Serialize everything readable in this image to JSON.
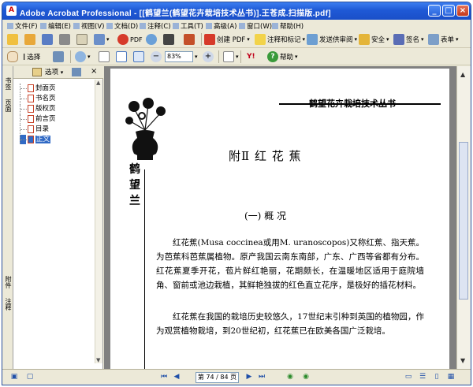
{
  "window": {
    "title": "Adobe Acrobat Professional - [[鹤望兰(鹤望花卉栽培技术丛书)].王苍成.扫描版.pdf]",
    "minimize": "_",
    "maximize": "□",
    "close": "×"
  },
  "menubar": {
    "items": [
      "文件(F)",
      "编辑(E)",
      "视图(V)",
      "文档(D)",
      "注释(C)",
      "工具(T)",
      "高级(A)",
      "窗口(W)",
      "帮助(H)"
    ]
  },
  "toolbar1": {
    "create_pdf_icon": "PDF",
    "create_pdf": "创建 PDF",
    "comment_markup": "注释和标记",
    "send_review": "发送供审阅",
    "security": "安全",
    "sign": "签名",
    "forms": "表单"
  },
  "toolbar2": {
    "select": "选择",
    "zoom": "83%",
    "help": "帮助"
  },
  "nav": {
    "tabs": [
      "书签",
      "页面",
      "附件",
      "注释"
    ],
    "options": "选项",
    "bookmarks": [
      "封面页",
      "书名页",
      "版权页",
      "前言页",
      "目录",
      "正文"
    ],
    "selected_index": 5
  },
  "document": {
    "header": "鹤望花卉栽培技术丛书",
    "side_title": "鹤望兰",
    "chapter": "附Ⅱ 红 花 蕉",
    "section": "(一) 概    况",
    "para1": "红花蕉(Musa coccinea或用M. uranoscopos)又称红蕉、指天蕉。为芭蕉科芭蕉属植物。原产我国云南东南部，广东、广西等省都有分布。红花蕉夏季开花，苞片鲜红艳丽，花期颇长，在温暖地区适用于庭院墙角、窗前或池边栽植，其鲜艳独拔的红色直立花序，是极好的插花材料。",
    "para2": "红花蕉在我国的栽培历史较悠久，17世纪末引种到英国的植物园，作为观赏植物栽培，到20世纪初，红花蕉已在欧美各国广泛栽培。"
  },
  "statusbar": {
    "page_display": "第 74 / 84 页"
  },
  "colors": {
    "titlebar": "#1f59d6",
    "chrome": "#ece9d8",
    "doc_background": "#808080",
    "selection": "#316ac5"
  }
}
